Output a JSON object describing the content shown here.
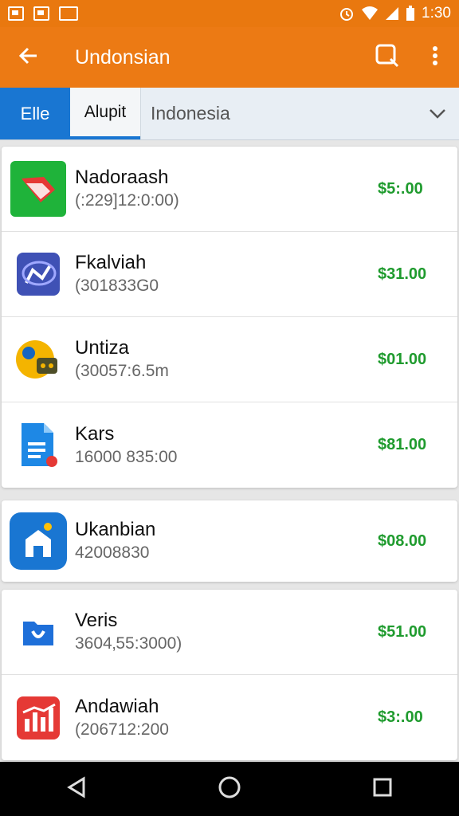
{
  "status_bar": {
    "time": "1:30",
    "icons": [
      "photo-icon",
      "gallery-icon",
      "app-icon",
      "alarm-icon",
      "wifi-icon",
      "signal-icon",
      "battery-icon"
    ]
  },
  "app_bar": {
    "title": "Undonsian",
    "back_icon": "arrow-back-icon",
    "search_icon": "search-icon",
    "menu_icon": "more-vert-icon"
  },
  "tabs": [
    {
      "label": "Elle",
      "active": true
    },
    {
      "label": "Alupit",
      "active": false
    }
  ],
  "country_select": {
    "value": "Indonesia",
    "icon": "chevron-down-icon"
  },
  "groups": [
    {
      "items": [
        {
          "name": "Nadoraash",
          "sub": "(:229]12:0:00)",
          "price": "$5:.00",
          "icon": "green-book-icon"
        },
        {
          "name": "Fkalviah",
          "sub": "(301833G0",
          "price": "$31.00",
          "icon": "chat-icon"
        },
        {
          "name": "Untiza",
          "sub": "(30057:6.5m",
          "price": "$01.00",
          "icon": "yellow-game-icon"
        },
        {
          "name": "Kars",
          "sub": "16000 835:00",
          "price": "$81.00",
          "icon": "document-icon"
        }
      ]
    },
    {
      "items": [
        {
          "name": "Ukanbian",
          "sub": "42008830",
          "price": "$08.00",
          "icon": "home-icon"
        }
      ]
    },
    {
      "items": [
        {
          "name": "Veris",
          "sub": "3604‚55:3000)",
          "price": "$51.00",
          "icon": "folder-icon"
        },
        {
          "name": "Andawiah",
          "sub": "(206712:200",
          "price": "$3:.00",
          "icon": "chart-icon"
        }
      ]
    }
  ],
  "colors": {
    "app_bar": "#ec7a14",
    "status_bar": "#e9780f",
    "tab_active": "#1976d2",
    "price": "#1f9b2e"
  }
}
